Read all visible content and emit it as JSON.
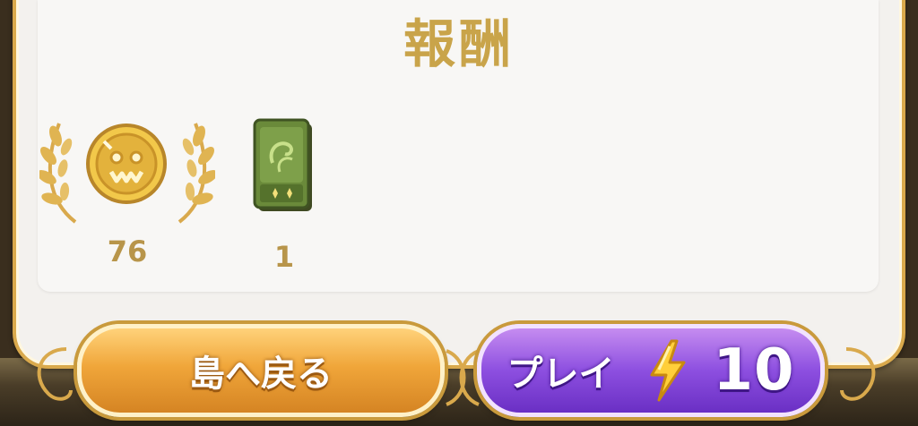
{
  "panel": {
    "title": "報酬"
  },
  "rewards": [
    {
      "icon": "gold-coin-icon",
      "amount": "76"
    },
    {
      "icon": "green-card-pack-icon",
      "amount": "1"
    }
  ],
  "buttons": {
    "back_label": "島へ戻る",
    "play_label": "プレイ",
    "play_cost_icon": "lightning-bolt-icon",
    "play_cost": "10"
  },
  "colors": {
    "gold_text": "#c9a44a",
    "back_button": "#f0a63a",
    "play_button": "#8d4fe0",
    "frame": "#d9a94c"
  }
}
